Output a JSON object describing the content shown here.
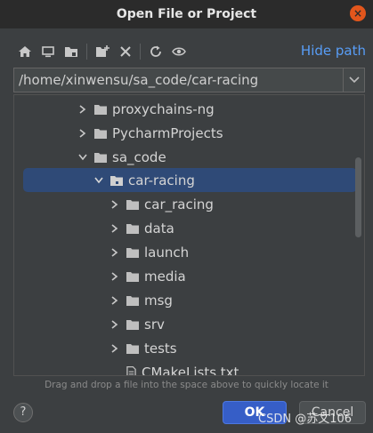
{
  "window": {
    "title": "Open File or Project",
    "close_symbol": "×"
  },
  "toolbar": {
    "icons": [
      "home-icon",
      "desktop-icon",
      "project-folder-icon",
      "new-folder-icon",
      "delete-icon",
      "refresh-icon",
      "show-hidden-icon"
    ],
    "hide_path_label": "Hide path"
  },
  "path": {
    "value": "/home/xinwensu/sa_code/car-racing"
  },
  "tree": {
    "items": [
      {
        "label": "proxychains-ng",
        "expanded": false,
        "type": "folder"
      },
      {
        "label": "PycharmProjects",
        "expanded": false,
        "type": "folder"
      },
      {
        "label": "sa_code",
        "expanded": true,
        "type": "folder"
      },
      {
        "label": "car-racing",
        "expanded": true,
        "type": "folder",
        "selected": true
      },
      {
        "label": "car_racing",
        "expanded": false,
        "type": "folder"
      },
      {
        "label": "data",
        "expanded": false,
        "type": "folder"
      },
      {
        "label": "launch",
        "expanded": false,
        "type": "folder"
      },
      {
        "label": "media",
        "expanded": false,
        "type": "folder"
      },
      {
        "label": "msg",
        "expanded": false,
        "type": "folder"
      },
      {
        "label": "srv",
        "expanded": false,
        "type": "folder"
      },
      {
        "label": "tests",
        "expanded": false,
        "type": "folder"
      },
      {
        "label": "CMakeLists.txt",
        "type": "file"
      }
    ]
  },
  "hint": "Drag and drop a file into the space above to quickly locate it",
  "buttons": {
    "help": "?",
    "ok": "OK",
    "cancel": "Cancel"
  },
  "watermark": "CSDN @苏文106",
  "colors": {
    "accent": "#365ec7",
    "selection": "#2f4a77",
    "link": "#589df6",
    "close": "#e2561c"
  }
}
